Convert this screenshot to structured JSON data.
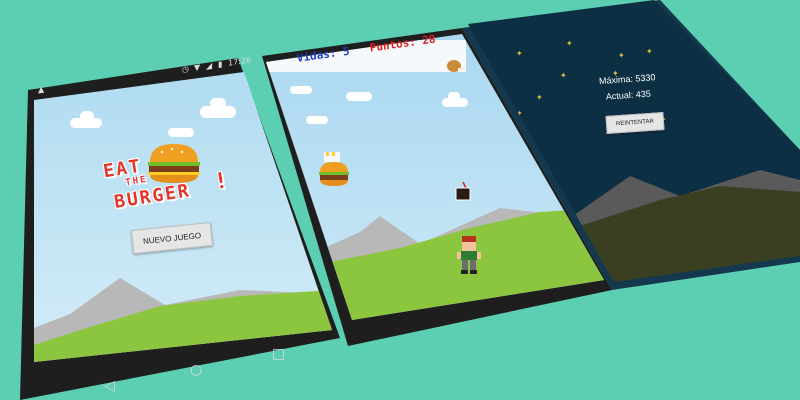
{
  "screens": {
    "menu": {
      "status_bar": {
        "time": "17:26"
      },
      "title": {
        "line1": "EAT",
        "line2": "THE",
        "line3": "BURGER",
        "bang": "!"
      },
      "new_game_button": "NUEVO JUEGO",
      "nav": {
        "back": "◁",
        "home": "○",
        "recents": "□"
      }
    },
    "game": {
      "hud": {
        "lives_label": "Vidas:",
        "lives_value": "5",
        "points_label": "Puntos:",
        "points_value": "28"
      }
    },
    "gameover": {
      "max_label": "Máxima:",
      "max_value": "5330",
      "current_label": "Actual:",
      "current_value": "435",
      "retry_button": "REINTENTAR"
    }
  },
  "icons": [
    "wifi-icon",
    "signal-icon",
    "battery-icon",
    "alarm-icon",
    "burger-icon",
    "soda-icon",
    "chicken-leg-icon",
    "player-sprite"
  ],
  "colors": {
    "background": "#5ccfb2",
    "phone_frame": "#1e1e1e",
    "grass": "#8cc63f",
    "mountain": "#b5b5b5",
    "night_sky": "#0d2f44",
    "title_red": "#e4352b",
    "hud_blue": "#1f3fbf",
    "hud_red": "#e01e1e"
  }
}
